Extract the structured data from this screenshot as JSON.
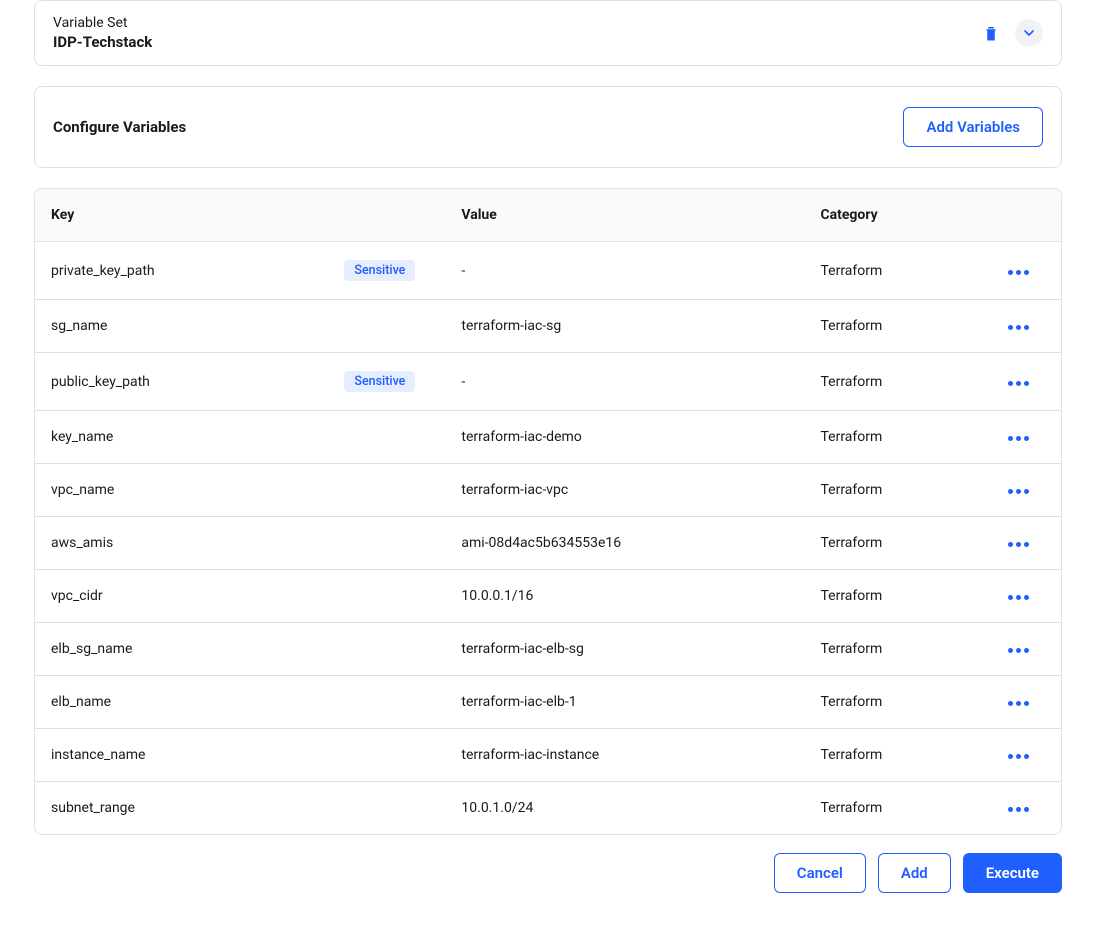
{
  "header": {
    "label": "Variable Set",
    "title": "IDP-Techstack"
  },
  "config": {
    "title": "Configure Variables",
    "addButton": "Add Variables"
  },
  "table": {
    "headers": {
      "key": "Key",
      "value": "Value",
      "category": "Category"
    },
    "sensitiveLabel": "Sensitive",
    "rows": [
      {
        "key": "private_key_path",
        "value": "-",
        "category": "Terraform",
        "sensitive": true
      },
      {
        "key": "sg_name",
        "value": "terraform-iac-sg",
        "category": "Terraform",
        "sensitive": false
      },
      {
        "key": "public_key_path",
        "value": "-",
        "category": "Terraform",
        "sensitive": true
      },
      {
        "key": "key_name",
        "value": "terraform-iac-demo",
        "category": "Terraform",
        "sensitive": false
      },
      {
        "key": "vpc_name",
        "value": "terraform-iac-vpc",
        "category": "Terraform",
        "sensitive": false
      },
      {
        "key": "aws_amis",
        "value": "ami-08d4ac5b634553e16",
        "category": "Terraform",
        "sensitive": false
      },
      {
        "key": "vpc_cidr",
        "value": "10.0.0.1/16",
        "category": "Terraform",
        "sensitive": false
      },
      {
        "key": "elb_sg_name",
        "value": "terraform-iac-elb-sg",
        "category": "Terraform",
        "sensitive": false
      },
      {
        "key": "elb_name",
        "value": "terraform-iac-elb-1",
        "category": "Terraform",
        "sensitive": false
      },
      {
        "key": "instance_name",
        "value": "terraform-iac-instance",
        "category": "Terraform",
        "sensitive": false
      },
      {
        "key": "subnet_range",
        "value": "10.0.1.0/24",
        "category": "Terraform",
        "sensitive": false
      }
    ]
  },
  "footer": {
    "cancel": "Cancel",
    "add": "Add",
    "execute": "Execute"
  }
}
